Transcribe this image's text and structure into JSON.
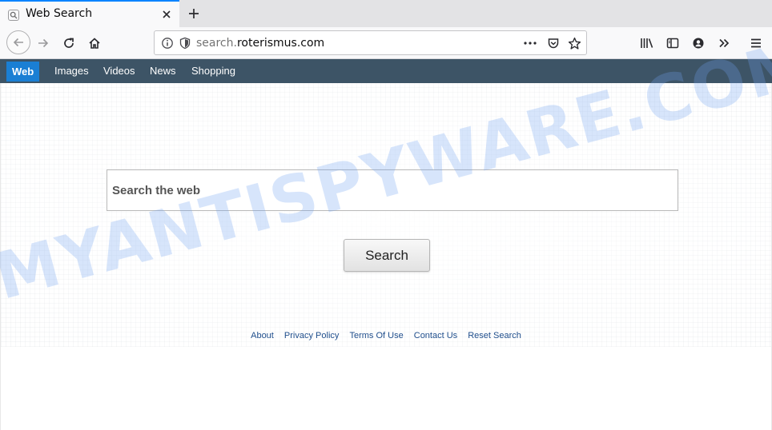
{
  "browser": {
    "tab": {
      "title": "Web Search"
    },
    "url": {
      "prefix": "search.",
      "domain": "roterismus.com"
    }
  },
  "site_nav": {
    "items": [
      {
        "label": "Web",
        "active": true
      },
      {
        "label": "Images"
      },
      {
        "label": "Videos"
      },
      {
        "label": "News"
      },
      {
        "label": "Shopping"
      }
    ]
  },
  "search": {
    "placeholder": "Search the web",
    "button_label": "Search"
  },
  "footer": {
    "links": [
      "About",
      "Privacy Policy",
      "Terms Of Use",
      "Contact Us",
      "Reset Search"
    ]
  },
  "watermark": "MYANTISPYWARE.COM",
  "colors": {
    "accent": "#0a84ff",
    "site_nav_bg": "#3d5466",
    "active_tab": "#1a7fd4",
    "link": "#1f4e8c"
  }
}
